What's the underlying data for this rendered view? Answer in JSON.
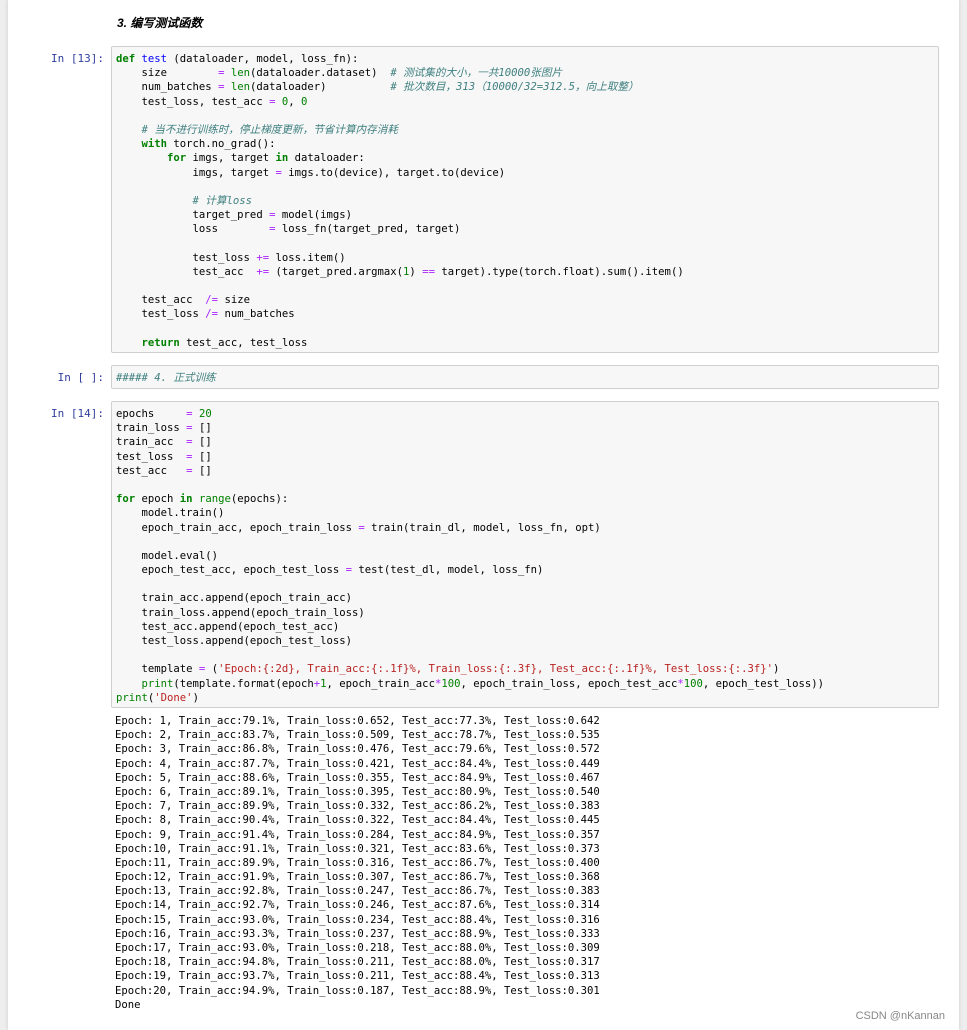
{
  "heading": "3. 编写测试函数",
  "cells": {
    "c13": {
      "prompt": "In [13]:",
      "lines": [
        [
          [
            "kw",
            "def "
          ],
          [
            "fn",
            "test"
          ],
          [
            "t",
            " (dataloader, model, loss_fn):"
          ]
        ],
        [
          [
            "t",
            "    size        "
          ],
          [
            "op",
            "="
          ],
          [
            "t",
            " "
          ],
          [
            "bi",
            "len"
          ],
          [
            "t",
            "(dataloader.dataset)  "
          ],
          [
            "cm",
            "# 测试集的大小，一共10000张图片"
          ]
        ],
        [
          [
            "t",
            "    num_batches "
          ],
          [
            "op",
            "="
          ],
          [
            "t",
            " "
          ],
          [
            "bi",
            "len"
          ],
          [
            "t",
            "(dataloader)          "
          ],
          [
            "cm",
            "# 批次数目，313（10000/32=312.5，向上取整）"
          ]
        ],
        [
          [
            "t",
            "    test_loss, test_acc "
          ],
          [
            "op",
            "="
          ],
          [
            "t",
            " "
          ],
          [
            "num",
            "0"
          ],
          [
            "t",
            ", "
          ],
          [
            "num",
            "0"
          ]
        ],
        [
          [
            "t",
            ""
          ]
        ],
        [
          [
            "t",
            "    "
          ],
          [
            "cm",
            "# 当不进行训练时，停止梯度更新，节省计算内存消耗"
          ]
        ],
        [
          [
            "t",
            "    "
          ],
          [
            "kw",
            "with"
          ],
          [
            "t",
            " torch.no_grad():"
          ]
        ],
        [
          [
            "t",
            "        "
          ],
          [
            "kw",
            "for"
          ],
          [
            "t",
            " imgs, target "
          ],
          [
            "kw",
            "in"
          ],
          [
            "t",
            " dataloader:"
          ]
        ],
        [
          [
            "t",
            "            imgs, target "
          ],
          [
            "op",
            "="
          ],
          [
            "t",
            " imgs.to(device), target.to(device)"
          ]
        ],
        [
          [
            "t",
            ""
          ]
        ],
        [
          [
            "t",
            "            "
          ],
          [
            "cm",
            "# 计算loss"
          ]
        ],
        [
          [
            "t",
            "            target_pred "
          ],
          [
            "op",
            "="
          ],
          [
            "t",
            " model(imgs)"
          ]
        ],
        [
          [
            "t",
            "            loss        "
          ],
          [
            "op",
            "="
          ],
          [
            "t",
            " loss_fn(target_pred, target)"
          ]
        ],
        [
          [
            "t",
            ""
          ]
        ],
        [
          [
            "t",
            "            test_loss "
          ],
          [
            "op",
            "+="
          ],
          [
            "t",
            " loss.item()"
          ]
        ],
        [
          [
            "t",
            "            test_acc  "
          ],
          [
            "op",
            "+="
          ],
          [
            "t",
            " (target_pred.argmax("
          ],
          [
            "num",
            "1"
          ],
          [
            "t",
            ") "
          ],
          [
            "op",
            "=="
          ],
          [
            "t",
            " target).type(torch.float).sum().item()"
          ]
        ],
        [
          [
            "t",
            ""
          ]
        ],
        [
          [
            "t",
            "    test_acc  "
          ],
          [
            "op",
            "/="
          ],
          [
            "t",
            " size"
          ]
        ],
        [
          [
            "t",
            "    test_loss "
          ],
          [
            "op",
            "/="
          ],
          [
            "t",
            " num_batches"
          ]
        ],
        [
          [
            "t",
            ""
          ]
        ],
        [
          [
            "t",
            "    "
          ],
          [
            "kw",
            "return"
          ],
          [
            "t",
            " test_acc, test_loss"
          ]
        ]
      ]
    },
    "cempty": {
      "prompt": "In [ ]:",
      "lines": [
        [
          [
            "cm",
            "##### 4. 正式训练"
          ]
        ]
      ]
    },
    "c14": {
      "prompt": "In [14]:",
      "lines": [
        [
          [
            "t",
            "epochs     "
          ],
          [
            "op",
            "="
          ],
          [
            "t",
            " "
          ],
          [
            "num",
            "20"
          ]
        ],
        [
          [
            "t",
            "train_loss "
          ],
          [
            "op",
            "="
          ],
          [
            "t",
            " []"
          ]
        ],
        [
          [
            "t",
            "train_acc  "
          ],
          [
            "op",
            "="
          ],
          [
            "t",
            " []"
          ]
        ],
        [
          [
            "t",
            "test_loss  "
          ],
          [
            "op",
            "="
          ],
          [
            "t",
            " []"
          ]
        ],
        [
          [
            "t",
            "test_acc   "
          ],
          [
            "op",
            "="
          ],
          [
            "t",
            " []"
          ]
        ],
        [
          [
            "t",
            ""
          ]
        ],
        [
          [
            "kw",
            "for"
          ],
          [
            "t",
            " epoch "
          ],
          [
            "kw",
            "in"
          ],
          [
            "t",
            " "
          ],
          [
            "bi",
            "range"
          ],
          [
            "t",
            "(epochs):"
          ]
        ],
        [
          [
            "t",
            "    model.train()"
          ]
        ],
        [
          [
            "t",
            "    epoch_train_acc, epoch_train_loss "
          ],
          [
            "op",
            "="
          ],
          [
            "t",
            " train(train_dl, model, loss_fn, opt)"
          ]
        ],
        [
          [
            "t",
            ""
          ]
        ],
        [
          [
            "t",
            "    model.eval()"
          ]
        ],
        [
          [
            "t",
            "    epoch_test_acc, epoch_test_loss "
          ],
          [
            "op",
            "="
          ],
          [
            "t",
            " test(test_dl, model, loss_fn)"
          ]
        ],
        [
          [
            "t",
            ""
          ]
        ],
        [
          [
            "t",
            "    train_acc.append(epoch_train_acc)"
          ]
        ],
        [
          [
            "t",
            "    train_loss.append(epoch_train_loss)"
          ]
        ],
        [
          [
            "t",
            "    test_acc.append(epoch_test_acc)"
          ]
        ],
        [
          [
            "t",
            "    test_loss.append(epoch_test_loss)"
          ]
        ],
        [
          [
            "t",
            ""
          ]
        ],
        [
          [
            "t",
            "    template "
          ],
          [
            "op",
            "="
          ],
          [
            "t",
            " ("
          ],
          [
            "st",
            "'Epoch:{:2d}, Train_acc:{:.1f}%, Train_loss:{:.3f}, Test_acc:{:.1f}%, Test_loss:{:.3f}'"
          ],
          [
            "t",
            ")"
          ]
        ],
        [
          [
            "t",
            "    "
          ],
          [
            "bi",
            "print"
          ],
          [
            "t",
            "(template.format(epoch"
          ],
          [
            "op",
            "+"
          ],
          [
            "num",
            "1"
          ],
          [
            "t",
            ", epoch_train_acc"
          ],
          [
            "op",
            "*"
          ],
          [
            "num",
            "100"
          ],
          [
            "t",
            ", epoch_train_loss, epoch_test_acc"
          ],
          [
            "op",
            "*"
          ],
          [
            "num",
            "100"
          ],
          [
            "t",
            ", epoch_test_loss))"
          ]
        ],
        [
          [
            "bi",
            "print"
          ],
          [
            "t",
            "("
          ],
          [
            "st",
            "'Done'"
          ],
          [
            "t",
            ")"
          ]
        ]
      ]
    }
  },
  "output_lines": [
    "Epoch: 1, Train_acc:79.1%, Train_loss:0.652, Test_acc:77.3%, Test_loss:0.642",
    "Epoch: 2, Train_acc:83.7%, Train_loss:0.509, Test_acc:78.7%, Test_loss:0.535",
    "Epoch: 3, Train_acc:86.8%, Train_loss:0.476, Test_acc:79.6%, Test_loss:0.572",
    "Epoch: 4, Train_acc:87.7%, Train_loss:0.421, Test_acc:84.4%, Test_loss:0.449",
    "Epoch: 5, Train_acc:88.6%, Train_loss:0.355, Test_acc:84.9%, Test_loss:0.467",
    "Epoch: 6, Train_acc:89.1%, Train_loss:0.395, Test_acc:80.9%, Test_loss:0.540",
    "Epoch: 7, Train_acc:89.9%, Train_loss:0.332, Test_acc:86.2%, Test_loss:0.383",
    "Epoch: 8, Train_acc:90.4%, Train_loss:0.322, Test_acc:84.4%, Test_loss:0.445",
    "Epoch: 9, Train_acc:91.4%, Train_loss:0.284, Test_acc:84.9%, Test_loss:0.357",
    "Epoch:10, Train_acc:91.1%, Train_loss:0.321, Test_acc:83.6%, Test_loss:0.373",
    "Epoch:11, Train_acc:89.9%, Train_loss:0.316, Test_acc:86.7%, Test_loss:0.400",
    "Epoch:12, Train_acc:91.9%, Train_loss:0.307, Test_acc:86.7%, Test_loss:0.368",
    "Epoch:13, Train_acc:92.8%, Train_loss:0.247, Test_acc:86.7%, Test_loss:0.383",
    "Epoch:14, Train_acc:92.7%, Train_loss:0.246, Test_acc:87.6%, Test_loss:0.314",
    "Epoch:15, Train_acc:93.0%, Train_loss:0.234, Test_acc:88.4%, Test_loss:0.316",
    "Epoch:16, Train_acc:93.3%, Train_loss:0.237, Test_acc:88.9%, Test_loss:0.333",
    "Epoch:17, Train_acc:93.0%, Train_loss:0.218, Test_acc:88.0%, Test_loss:0.309",
    "Epoch:18, Train_acc:94.8%, Train_loss:0.211, Test_acc:88.0%, Test_loss:0.317",
    "Epoch:19, Train_acc:93.7%, Train_loss:0.211, Test_acc:88.4%, Test_loss:0.313",
    "Epoch:20, Train_acc:94.9%, Train_loss:0.187, Test_acc:88.9%, Test_loss:0.301",
    "Done"
  ],
  "watermark": "CSDN @nKannan",
  "colors": {
    "prompt": "#303f9f",
    "keyword": "#008000",
    "operator": "#aa22ff",
    "comment": "#408080",
    "string": "#ba2121",
    "function": "#0000ff"
  }
}
